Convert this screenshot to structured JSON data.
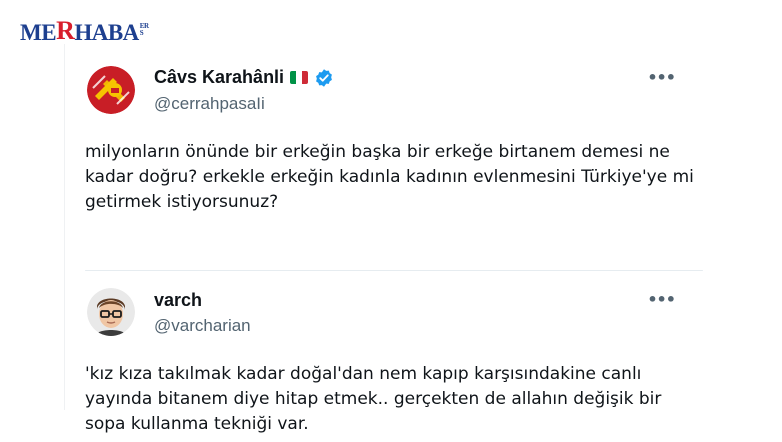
{
  "logo": {
    "m": "ME",
    "r": "R",
    "rest": "HABA",
    "tail_top": "ER",
    "tail_bottom": "S"
  },
  "tweets": [
    {
      "name": "Câvs Karahânli",
      "handle": "@cerrahpasaIi",
      "flag": "italy-flag-icon",
      "verified": true,
      "text": "milyonların önünde bir erkeğin başka bir erkeğe birtanem demesi ne kadar doğru? erkekle erkeğin kadınla kadının evlenmesini Türkiye'ye mi getirmek istiyorsunuz?",
      "more": "•••"
    },
    {
      "name": "varch",
      "handle": "@varcharian",
      "text": "'kız kıza takılmak kadar doğal'dan nem kapıp karşısındakine canlı yayında bitanem diye hitap etmek.. gerçekten de allahın değişik bir sopa kullanma tekniği var.",
      "more": "•••"
    }
  ],
  "colors": {
    "brand_blue": "#1d3f8f",
    "brand_red": "#d81e2c",
    "text": "#0f1419",
    "muted": "#536471",
    "verified": "#1d9bf0"
  }
}
